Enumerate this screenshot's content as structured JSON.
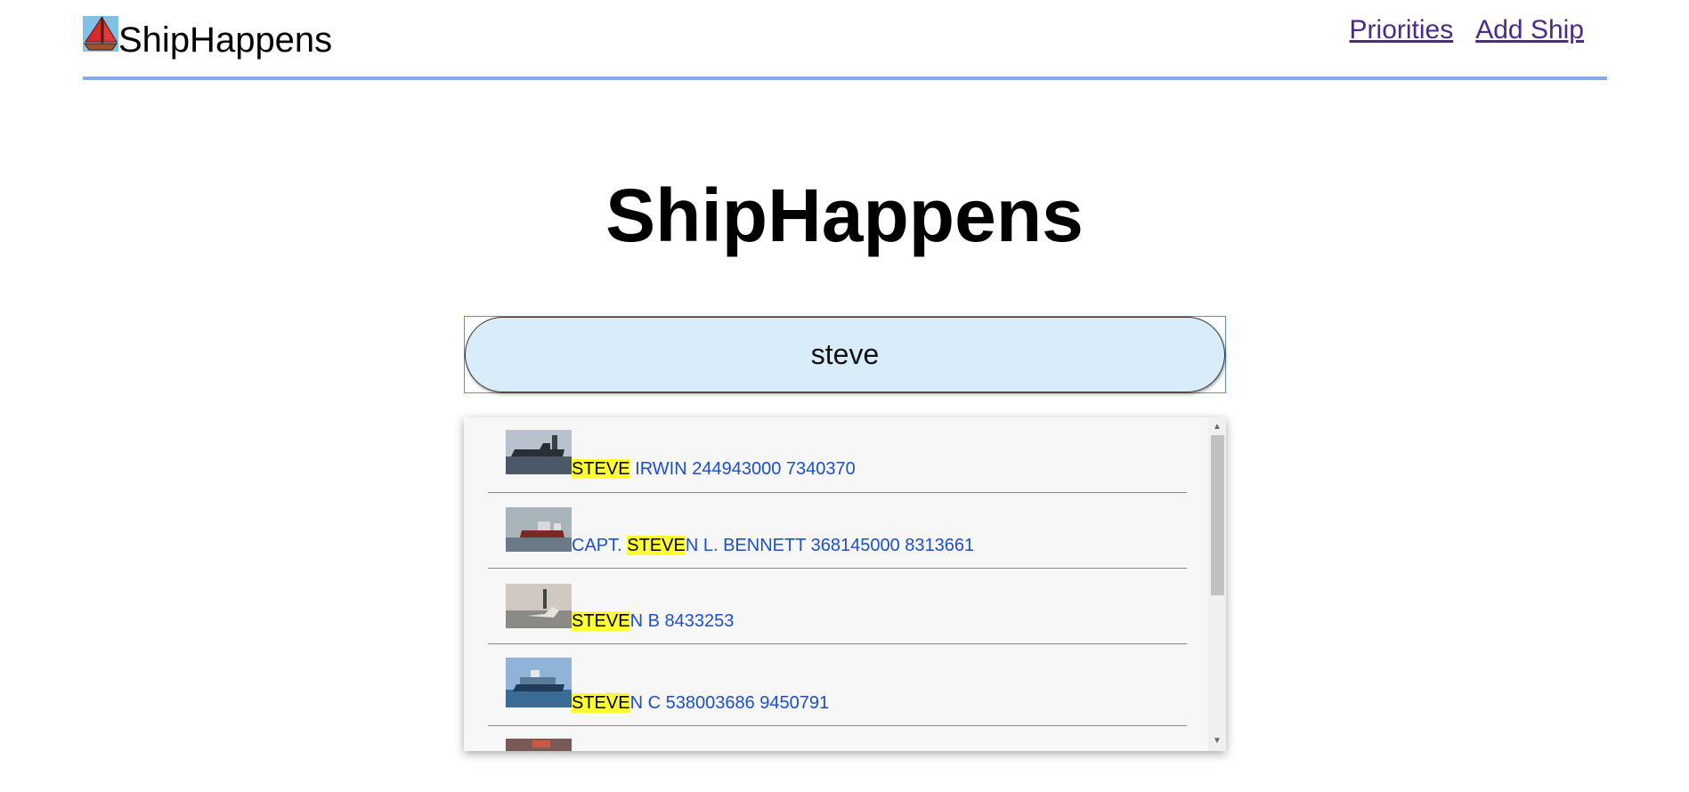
{
  "header": {
    "logo_icon": "sailboat-icon",
    "brand": "ShipHappens",
    "nav": [
      {
        "label": "Priorities"
      },
      {
        "label": "Add Ship"
      }
    ],
    "underline_color": "#8aa9e8",
    "link_color": "#4b2a8a"
  },
  "main": {
    "title": "ShipHappens",
    "search": {
      "value": "steve"
    }
  },
  "results": {
    "highlight_color": "#ffff33",
    "link_color": "#1a4fd0",
    "items": [
      {
        "pre": "",
        "match": "STEVE",
        "post": " IRWIN 244943000 7340370",
        "thumb": "ship-photo"
      },
      {
        "pre": "CAPT. ",
        "match": "STEVE",
        "post": "N L. BENNETT 368145000 8313661",
        "thumb": "ship-photo"
      },
      {
        "pre": "",
        "match": "STEVE",
        "post": "N B 8433253",
        "thumb": "ship-photo"
      },
      {
        "pre": "",
        "match": "STEVE",
        "post": "N C 538003686 9450791",
        "thumb": "ship-photo"
      },
      {
        "pre": "",
        "match": "",
        "post": "",
        "thumb": "ship-photo"
      }
    ]
  },
  "scrollbar": {
    "up_icon": "scroll-up-arrow-icon",
    "down_icon": "scroll-down-arrow-icon",
    "up_glyph": "▲",
    "down_glyph": "▼"
  }
}
